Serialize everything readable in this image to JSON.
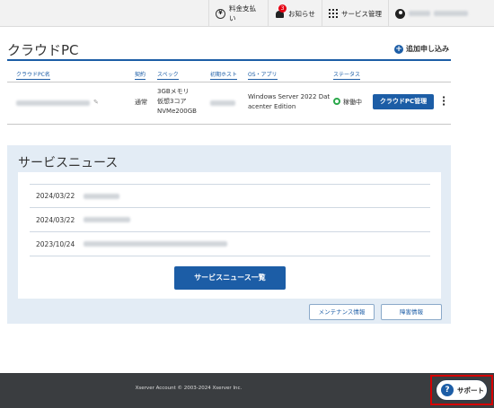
{
  "header": {
    "payment_label": "料金支払い",
    "payment_icon": "yen-circle-icon",
    "notices_label": "お知らせ",
    "notices_badge": "3",
    "service_label": "サービス管理",
    "account_name_masked": true
  },
  "page": {
    "title": "クラウドPC",
    "add_label": "追加申し込み"
  },
  "table": {
    "headers": [
      "クラウドPC名",
      "契約",
      "スペック",
      "初期ホスト",
      "OS・アプリ",
      "ステータス"
    ],
    "rows": [
      {
        "contract": "通常",
        "spec_lines": [
          "3GBメモリ",
          "仮想3コア",
          "NVMe200GB"
        ],
        "os_lines": [
          "Windows Server 2022 Dat",
          "acenter Edition"
        ],
        "status": "稼働中",
        "manage_button": "クラウドPC管理"
      }
    ]
  },
  "news": {
    "title": "サービスニュース",
    "items": [
      {
        "date": "2024/03/22"
      },
      {
        "date": "2024/03/22"
      },
      {
        "date": "2023/10/24"
      }
    ],
    "list_button": "サービスニュース一覧",
    "maintenance_button": "メンテナンス情報",
    "failure_button": "障害情報"
  },
  "footer": {
    "copyright": "Xserver Account © 2003-2024 Xserver Inc.",
    "support_label": "サポート"
  },
  "colors": {
    "accent": "#1c5da6",
    "status_ok": "#2aa84a",
    "badge": "#e60012",
    "footer_bg": "#3a3d40",
    "highlight": "#d60000"
  }
}
